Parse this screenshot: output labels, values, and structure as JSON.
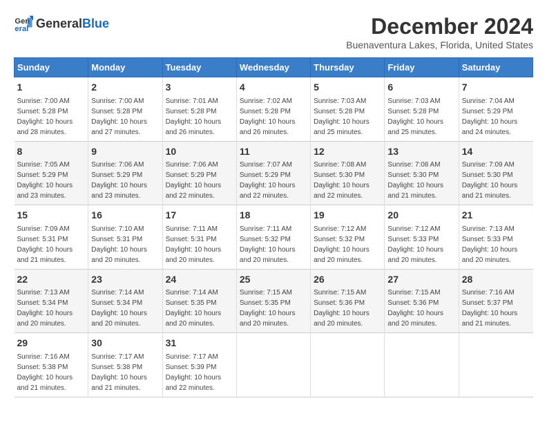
{
  "header": {
    "logo_general": "General",
    "logo_blue": "Blue",
    "title": "December 2024",
    "subtitle": "Buenaventura Lakes, Florida, United States"
  },
  "days_of_week": [
    "Sunday",
    "Monday",
    "Tuesday",
    "Wednesday",
    "Thursday",
    "Friday",
    "Saturday"
  ],
  "weeks": [
    [
      {
        "day": "1",
        "sunrise": "7:00 AM",
        "sunset": "5:28 PM",
        "daylight": "10 hours and 28 minutes."
      },
      {
        "day": "2",
        "sunrise": "7:00 AM",
        "sunset": "5:28 PM",
        "daylight": "10 hours and 27 minutes."
      },
      {
        "day": "3",
        "sunrise": "7:01 AM",
        "sunset": "5:28 PM",
        "daylight": "10 hours and 26 minutes."
      },
      {
        "day": "4",
        "sunrise": "7:02 AM",
        "sunset": "5:28 PM",
        "daylight": "10 hours and 26 minutes."
      },
      {
        "day": "5",
        "sunrise": "7:03 AM",
        "sunset": "5:28 PM",
        "daylight": "10 hours and 25 minutes."
      },
      {
        "day": "6",
        "sunrise": "7:03 AM",
        "sunset": "5:28 PM",
        "daylight": "10 hours and 25 minutes."
      },
      {
        "day": "7",
        "sunrise": "7:04 AM",
        "sunset": "5:29 PM",
        "daylight": "10 hours and 24 minutes."
      }
    ],
    [
      {
        "day": "8",
        "sunrise": "7:05 AM",
        "sunset": "5:29 PM",
        "daylight": "10 hours and 23 minutes."
      },
      {
        "day": "9",
        "sunrise": "7:06 AM",
        "sunset": "5:29 PM",
        "daylight": "10 hours and 23 minutes."
      },
      {
        "day": "10",
        "sunrise": "7:06 AM",
        "sunset": "5:29 PM",
        "daylight": "10 hours and 22 minutes."
      },
      {
        "day": "11",
        "sunrise": "7:07 AM",
        "sunset": "5:29 PM",
        "daylight": "10 hours and 22 minutes."
      },
      {
        "day": "12",
        "sunrise": "7:08 AM",
        "sunset": "5:30 PM",
        "daylight": "10 hours and 22 minutes."
      },
      {
        "day": "13",
        "sunrise": "7:08 AM",
        "sunset": "5:30 PM",
        "daylight": "10 hours and 21 minutes."
      },
      {
        "day": "14",
        "sunrise": "7:09 AM",
        "sunset": "5:30 PM",
        "daylight": "10 hours and 21 minutes."
      }
    ],
    [
      {
        "day": "15",
        "sunrise": "7:09 AM",
        "sunset": "5:31 PM",
        "daylight": "10 hours and 21 minutes."
      },
      {
        "day": "16",
        "sunrise": "7:10 AM",
        "sunset": "5:31 PM",
        "daylight": "10 hours and 20 minutes."
      },
      {
        "day": "17",
        "sunrise": "7:11 AM",
        "sunset": "5:31 PM",
        "daylight": "10 hours and 20 minutes."
      },
      {
        "day": "18",
        "sunrise": "7:11 AM",
        "sunset": "5:32 PM",
        "daylight": "10 hours and 20 minutes."
      },
      {
        "day": "19",
        "sunrise": "7:12 AM",
        "sunset": "5:32 PM",
        "daylight": "10 hours and 20 minutes."
      },
      {
        "day": "20",
        "sunrise": "7:12 AM",
        "sunset": "5:33 PM",
        "daylight": "10 hours and 20 minutes."
      },
      {
        "day": "21",
        "sunrise": "7:13 AM",
        "sunset": "5:33 PM",
        "daylight": "10 hours and 20 minutes."
      }
    ],
    [
      {
        "day": "22",
        "sunrise": "7:13 AM",
        "sunset": "5:34 PM",
        "daylight": "10 hours and 20 minutes."
      },
      {
        "day": "23",
        "sunrise": "7:14 AM",
        "sunset": "5:34 PM",
        "daylight": "10 hours and 20 minutes."
      },
      {
        "day": "24",
        "sunrise": "7:14 AM",
        "sunset": "5:35 PM",
        "daylight": "10 hours and 20 minutes."
      },
      {
        "day": "25",
        "sunrise": "7:15 AM",
        "sunset": "5:35 PM",
        "daylight": "10 hours and 20 minutes."
      },
      {
        "day": "26",
        "sunrise": "7:15 AM",
        "sunset": "5:36 PM",
        "daylight": "10 hours and 20 minutes."
      },
      {
        "day": "27",
        "sunrise": "7:15 AM",
        "sunset": "5:36 PM",
        "daylight": "10 hours and 20 minutes."
      },
      {
        "day": "28",
        "sunrise": "7:16 AM",
        "sunset": "5:37 PM",
        "daylight": "10 hours and 21 minutes."
      }
    ],
    [
      {
        "day": "29",
        "sunrise": "7:16 AM",
        "sunset": "5:38 PM",
        "daylight": "10 hours and 21 minutes."
      },
      {
        "day": "30",
        "sunrise": "7:17 AM",
        "sunset": "5:38 PM",
        "daylight": "10 hours and 21 minutes."
      },
      {
        "day": "31",
        "sunrise": "7:17 AM",
        "sunset": "5:39 PM",
        "daylight": "10 hours and 22 minutes."
      },
      null,
      null,
      null,
      null
    ]
  ],
  "labels": {
    "sunrise": "Sunrise:",
    "sunset": "Sunset:",
    "daylight": "Daylight:"
  }
}
